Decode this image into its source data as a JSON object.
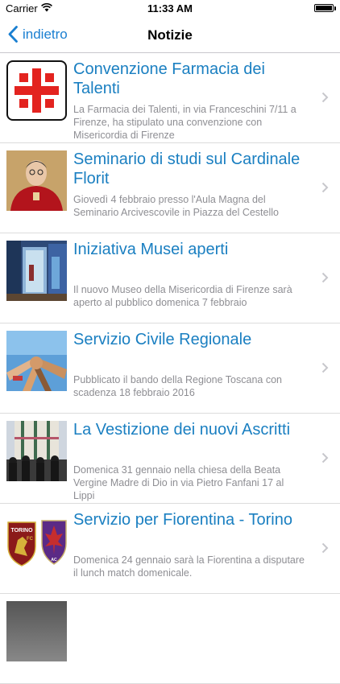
{
  "status": {
    "carrier": "Carrier",
    "time": "11:33 AM"
  },
  "nav": {
    "back_label": "indietro",
    "title": "Notizie"
  },
  "news": [
    {
      "title": "Convenzione Farmacia dei Talenti",
      "summary": "La Farmacia dei Talenti, in via Franceschini 7/11 a Firenze, ha stipulato una convenzione con Misericordia di Firenze"
    },
    {
      "title": "Seminario di studi sul Cardinale Florit",
      "summary": "Giovedì 4 febbraio presso l'Aula Magna del Seminario Arcivescovile in Piazza del Cestello"
    },
    {
      "title": "Iniziativa Musei aperti",
      "summary": "Il nuovo Museo della Misericordia di Firenze sarà aperto al pubblico domenica 7 febbraio"
    },
    {
      "title": "Servizio Civile Regionale",
      "summary": "Pubblicato il bando della Regione Toscana con scadenza 18 febbraio 2016"
    },
    {
      "title": "La Vestizione dei nuovi Ascritti",
      "summary": "Domenica 31 gennaio nella chiesa della Beata Vergine Madre di Dio in via Pietro Fanfani 17 al Lippi"
    },
    {
      "title": "Servizio per Fiorentina - Torino",
      "summary": "Domenica 24 gennaio sarà la Fiorentina a disputare il lunch match domenicale."
    }
  ],
  "logos": {
    "torino": "TORINO",
    "torino_fc": "FC",
    "fiorentina_ac": "AC"
  },
  "colors": {
    "accent": "#1a7fc1",
    "pharmacy_red": "#e3231f"
  }
}
